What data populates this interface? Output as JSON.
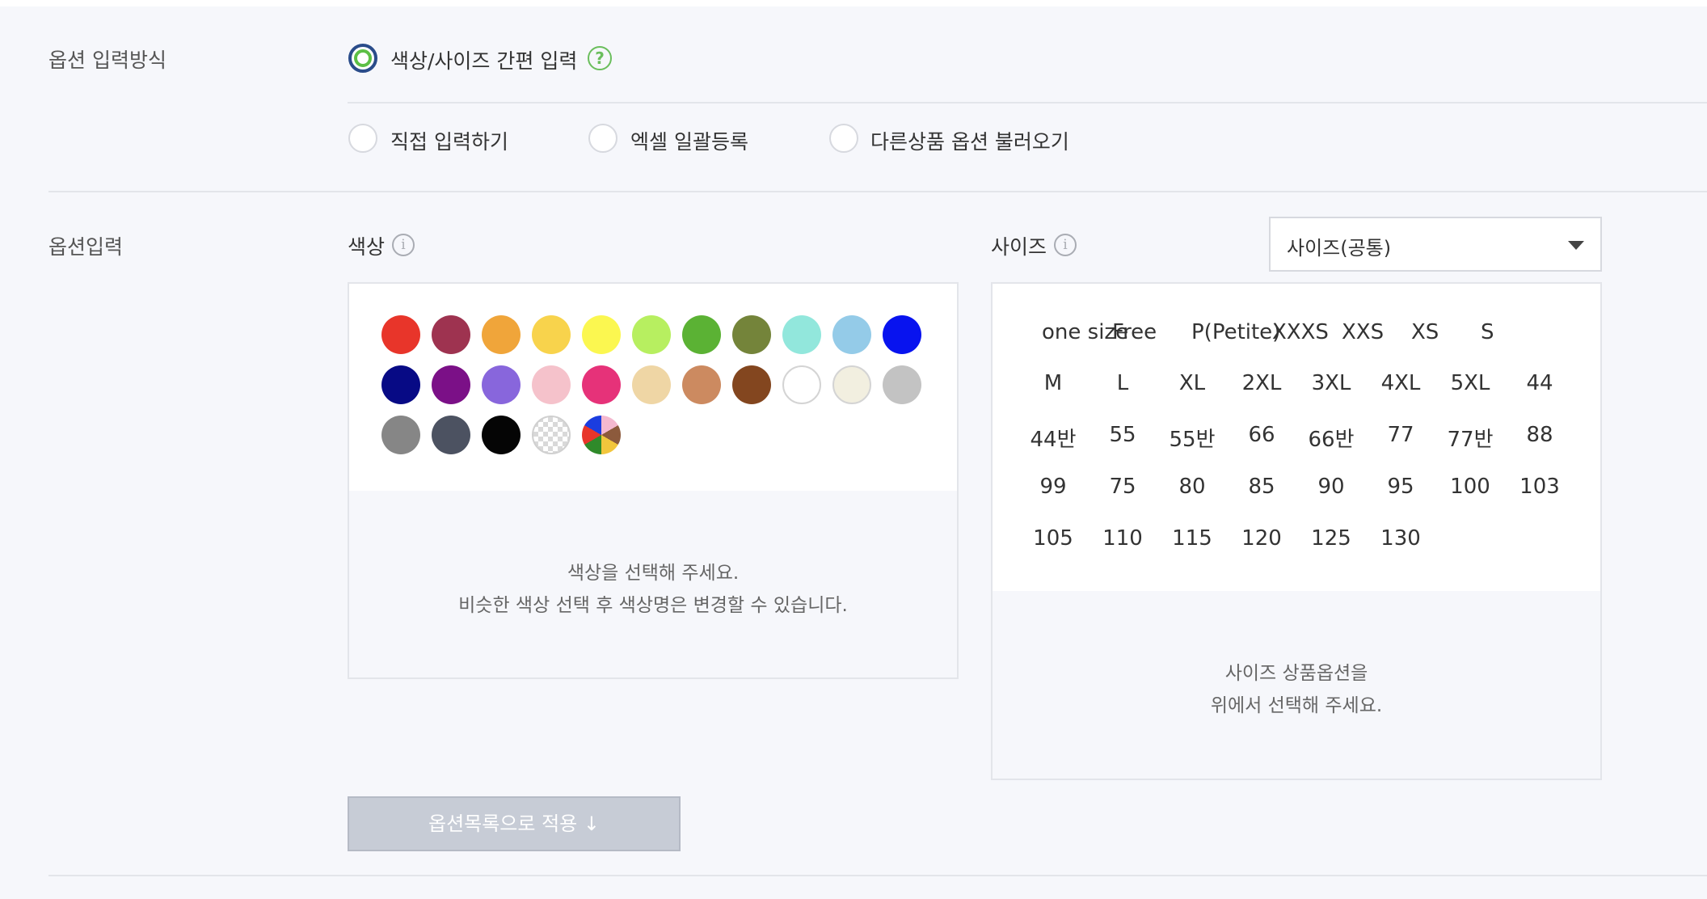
{
  "option_method": {
    "label": "옵션 입력방식",
    "easy": "색상/사이즈 간편 입력",
    "direct": "직접 입력하기",
    "excel": "엑셀 일괄등록",
    "import": "다른상품 옵션 불러오기",
    "help_glyph": "?"
  },
  "option_input": {
    "label": "옵션입력",
    "info_glyph": "i"
  },
  "color": {
    "title": "색상",
    "swatches": [
      "#e8352a",
      "#9e3350",
      "#f0a53a",
      "#f8d34c",
      "#fbf750",
      "#b7ef60",
      "#5bb234",
      "#74843a",
      "#92e7dc",
      "#94cbe8",
      "#0813ef",
      "#070a85",
      "#7b1087",
      "#8866dc",
      "#f5c2cb",
      "#e63279",
      "#efd6a5",
      "#cc8a60",
      "#83461f",
      "#ffffff",
      "#f2efe0",
      "#c3c3c3",
      "#868686",
      "#4c5261",
      "#050505",
      "checker",
      "multi"
    ],
    "hint1": "색상을 선택해 주세요.",
    "hint2": "비슷한 색상 선택 후 색상명은 변경할 수 있습니다."
  },
  "size": {
    "title": "사이즈",
    "select_value": "사이즈(공통)",
    "row1": [
      "one size",
      "Free",
      "P(Petite)",
      "XXXS",
      "XXS",
      "XS",
      "S"
    ],
    "items": [
      "M",
      "L",
      "XL",
      "2XL",
      "3XL",
      "4XL",
      "5XL",
      "44",
      "44반",
      "55",
      "55반",
      "66",
      "66반",
      "77",
      "77반",
      "88",
      "99",
      "75",
      "80",
      "85",
      "90",
      "95",
      "100",
      "103",
      "105",
      "110",
      "115",
      "120",
      "125",
      "130"
    ],
    "hint1": "사이즈 상품옵션을",
    "hint2": "위에서 선택해 주세요."
  },
  "apply_button": "옵션목록으로 적용 ↓"
}
